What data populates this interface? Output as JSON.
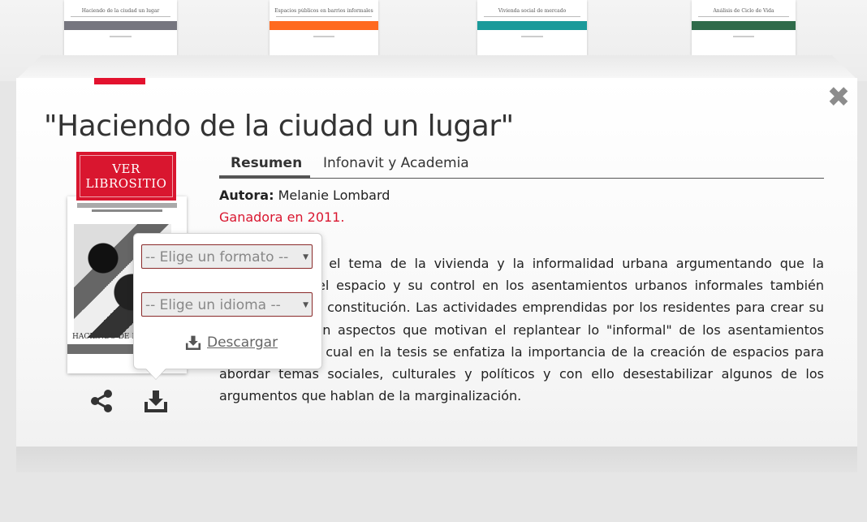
{
  "shelf": {
    "books": [
      {
        "title": "Haciendo de la ciudad un lugar",
        "band_color": "#76767f"
      },
      {
        "title": "Espacios públicos en barrios informales",
        "band_color": "#ff6a1f"
      },
      {
        "title": "Vivienda social de mercado",
        "band_color": "#1a9a9a"
      },
      {
        "title": "Análisis de Ciclo de Vida",
        "band_color": "#2f6b4a"
      }
    ]
  },
  "detail": {
    "title": "\"Haciendo de la ciudad un lugar\"",
    "close_icon": "close-icon",
    "cover": {
      "badge_line1": "VER",
      "badge_line2": "LIBROSITIO",
      "cover_title": "HACIENDO DE LA CIUDAD UN LUGAR"
    },
    "actions": {
      "share_icon": "share-icon",
      "download_icon": "download-icon"
    },
    "download_popover": {
      "format_placeholder": "-- Elige un formato --",
      "language_placeholder": "-- Elige un idioma --",
      "download_label": "Descargar"
    },
    "tabs": [
      {
        "label": "Resumen",
        "active": true
      },
      {
        "label": "Infonavit y Academia",
        "active": false
      }
    ],
    "author_label": "Autora:",
    "author_name": "Melanie Lombard",
    "award": "Ganadora en 2011.",
    "summary": "El libro aborda el tema de la vivienda y la informalidad urbana argumentando que la construcción del espacio y su control en los asentamientos urbanos informales también contribuye a su constitución. Las actividades emprendidas por los residentes para crear su propio lugar son aspectos que motivan el replantear lo \"informal\" de los asentamientos urbanos, por lo cual en la tesis se enfatiza la importancia de la creación de espacios para abordar temas sociales, culturales y políticos y con ello desestabilizar algunos de los argumentos que hablan de la marginalización."
  },
  "colors": {
    "accent_red": "#d9162f",
    "select_border": "#8a2a2a"
  }
}
